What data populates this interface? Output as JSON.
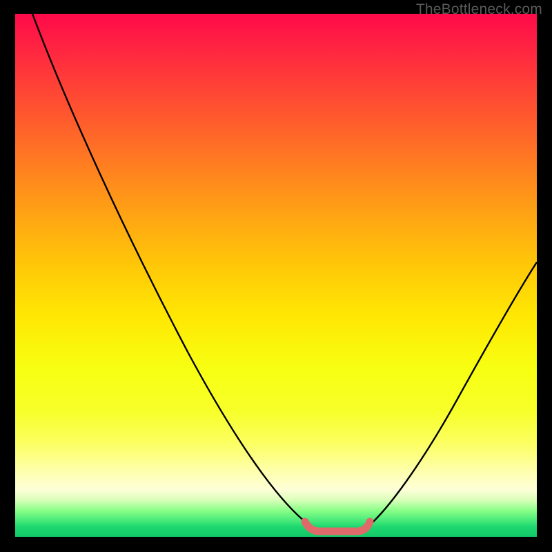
{
  "watermark": "TheBottleneck.com",
  "colors": {
    "background": "#000000",
    "gradient_top": "#ff0a4a",
    "gradient_mid_upper": "#ff7a22",
    "gradient_mid": "#ffe803",
    "gradient_mid_lower": "#fcff60",
    "gradient_bottom": "#10c868",
    "curve": "#000000",
    "optimum_highlight": "#e06a6a",
    "watermark_text": "#5a5a5a"
  },
  "chart_data": {
    "type": "line",
    "title": "",
    "xlabel": "",
    "ylabel": "",
    "x_range": [
      0,
      100
    ],
    "y_range": [
      0,
      100
    ],
    "left_curve": [
      {
        "x": 4,
        "y": 100
      },
      {
        "x": 12,
        "y": 82
      },
      {
        "x": 20,
        "y": 64
      },
      {
        "x": 28,
        "y": 47
      },
      {
        "x": 36,
        "y": 31
      },
      {
        "x": 44,
        "y": 16
      },
      {
        "x": 50,
        "y": 7
      },
      {
        "x": 54,
        "y": 3
      },
      {
        "x": 57,
        "y": 1.5
      }
    ],
    "right_curve": [
      {
        "x": 67,
        "y": 1.5
      },
      {
        "x": 70,
        "y": 4
      },
      {
        "x": 74,
        "y": 9
      },
      {
        "x": 80,
        "y": 18
      },
      {
        "x": 86,
        "y": 28
      },
      {
        "x": 92,
        "y": 38
      },
      {
        "x": 98,
        "y": 48
      },
      {
        "x": 100,
        "y": 52
      }
    ],
    "optimum_band": {
      "x_start": 55,
      "x_end": 68,
      "y": 1.2
    },
    "note": "V-shaped bottleneck curve. X likely component performance metric, Y likely bottleneck percentage. Minimum (optimal match) occurs roughly at x=57–68. No axis ticks or numeric labels are visible in the image; numeric values are estimated from pixel positions on a 0–100 normalized scale."
  }
}
